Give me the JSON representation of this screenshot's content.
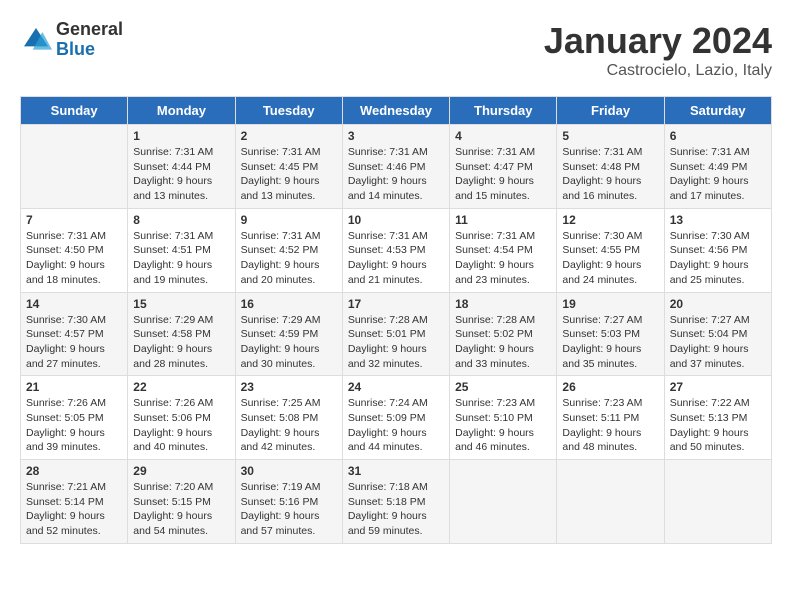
{
  "header": {
    "logo_general": "General",
    "logo_blue": "Blue",
    "month_title": "January 2024",
    "location": "Castrocielo, Lazio, Italy"
  },
  "days_of_week": [
    "Sunday",
    "Monday",
    "Tuesday",
    "Wednesday",
    "Thursday",
    "Friday",
    "Saturday"
  ],
  "weeks": [
    [
      {
        "day": "",
        "sunrise": "",
        "sunset": "",
        "daylight": ""
      },
      {
        "day": "1",
        "sunrise": "7:31 AM",
        "sunset": "4:44 PM",
        "daylight": "9 hours and 13 minutes."
      },
      {
        "day": "2",
        "sunrise": "7:31 AM",
        "sunset": "4:45 PM",
        "daylight": "9 hours and 13 minutes."
      },
      {
        "day": "3",
        "sunrise": "7:31 AM",
        "sunset": "4:46 PM",
        "daylight": "9 hours and 14 minutes."
      },
      {
        "day": "4",
        "sunrise": "7:31 AM",
        "sunset": "4:47 PM",
        "daylight": "9 hours and 15 minutes."
      },
      {
        "day": "5",
        "sunrise": "7:31 AM",
        "sunset": "4:48 PM",
        "daylight": "9 hours and 16 minutes."
      },
      {
        "day": "6",
        "sunrise": "7:31 AM",
        "sunset": "4:49 PM",
        "daylight": "9 hours and 17 minutes."
      }
    ],
    [
      {
        "day": "7",
        "sunrise": "7:31 AM",
        "sunset": "4:50 PM",
        "daylight": "9 hours and 18 minutes."
      },
      {
        "day": "8",
        "sunrise": "7:31 AM",
        "sunset": "4:51 PM",
        "daylight": "9 hours and 19 minutes."
      },
      {
        "day": "9",
        "sunrise": "7:31 AM",
        "sunset": "4:52 PM",
        "daylight": "9 hours and 20 minutes."
      },
      {
        "day": "10",
        "sunrise": "7:31 AM",
        "sunset": "4:53 PM",
        "daylight": "9 hours and 21 minutes."
      },
      {
        "day": "11",
        "sunrise": "7:31 AM",
        "sunset": "4:54 PM",
        "daylight": "9 hours and 23 minutes."
      },
      {
        "day": "12",
        "sunrise": "7:30 AM",
        "sunset": "4:55 PM",
        "daylight": "9 hours and 24 minutes."
      },
      {
        "day": "13",
        "sunrise": "7:30 AM",
        "sunset": "4:56 PM",
        "daylight": "9 hours and 25 minutes."
      }
    ],
    [
      {
        "day": "14",
        "sunrise": "7:30 AM",
        "sunset": "4:57 PM",
        "daylight": "9 hours and 27 minutes."
      },
      {
        "day": "15",
        "sunrise": "7:29 AM",
        "sunset": "4:58 PM",
        "daylight": "9 hours and 28 minutes."
      },
      {
        "day": "16",
        "sunrise": "7:29 AM",
        "sunset": "4:59 PM",
        "daylight": "9 hours and 30 minutes."
      },
      {
        "day": "17",
        "sunrise": "7:28 AM",
        "sunset": "5:01 PM",
        "daylight": "9 hours and 32 minutes."
      },
      {
        "day": "18",
        "sunrise": "7:28 AM",
        "sunset": "5:02 PM",
        "daylight": "9 hours and 33 minutes."
      },
      {
        "day": "19",
        "sunrise": "7:27 AM",
        "sunset": "5:03 PM",
        "daylight": "9 hours and 35 minutes."
      },
      {
        "day": "20",
        "sunrise": "7:27 AM",
        "sunset": "5:04 PM",
        "daylight": "9 hours and 37 minutes."
      }
    ],
    [
      {
        "day": "21",
        "sunrise": "7:26 AM",
        "sunset": "5:05 PM",
        "daylight": "9 hours and 39 minutes."
      },
      {
        "day": "22",
        "sunrise": "7:26 AM",
        "sunset": "5:06 PM",
        "daylight": "9 hours and 40 minutes."
      },
      {
        "day": "23",
        "sunrise": "7:25 AM",
        "sunset": "5:08 PM",
        "daylight": "9 hours and 42 minutes."
      },
      {
        "day": "24",
        "sunrise": "7:24 AM",
        "sunset": "5:09 PM",
        "daylight": "9 hours and 44 minutes."
      },
      {
        "day": "25",
        "sunrise": "7:23 AM",
        "sunset": "5:10 PM",
        "daylight": "9 hours and 46 minutes."
      },
      {
        "day": "26",
        "sunrise": "7:23 AM",
        "sunset": "5:11 PM",
        "daylight": "9 hours and 48 minutes."
      },
      {
        "day": "27",
        "sunrise": "7:22 AM",
        "sunset": "5:13 PM",
        "daylight": "9 hours and 50 minutes."
      }
    ],
    [
      {
        "day": "28",
        "sunrise": "7:21 AM",
        "sunset": "5:14 PM",
        "daylight": "9 hours and 52 minutes."
      },
      {
        "day": "29",
        "sunrise": "7:20 AM",
        "sunset": "5:15 PM",
        "daylight": "9 hours and 54 minutes."
      },
      {
        "day": "30",
        "sunrise": "7:19 AM",
        "sunset": "5:16 PM",
        "daylight": "9 hours and 57 minutes."
      },
      {
        "day": "31",
        "sunrise": "7:18 AM",
        "sunset": "5:18 PM",
        "daylight": "9 hours and 59 minutes."
      },
      {
        "day": "",
        "sunrise": "",
        "sunset": "",
        "daylight": ""
      },
      {
        "day": "",
        "sunrise": "",
        "sunset": "",
        "daylight": ""
      },
      {
        "day": "",
        "sunrise": "",
        "sunset": "",
        "daylight": ""
      }
    ]
  ],
  "labels": {
    "sunrise_prefix": "Sunrise: ",
    "sunset_prefix": "Sunset: ",
    "daylight_prefix": "Daylight: "
  }
}
